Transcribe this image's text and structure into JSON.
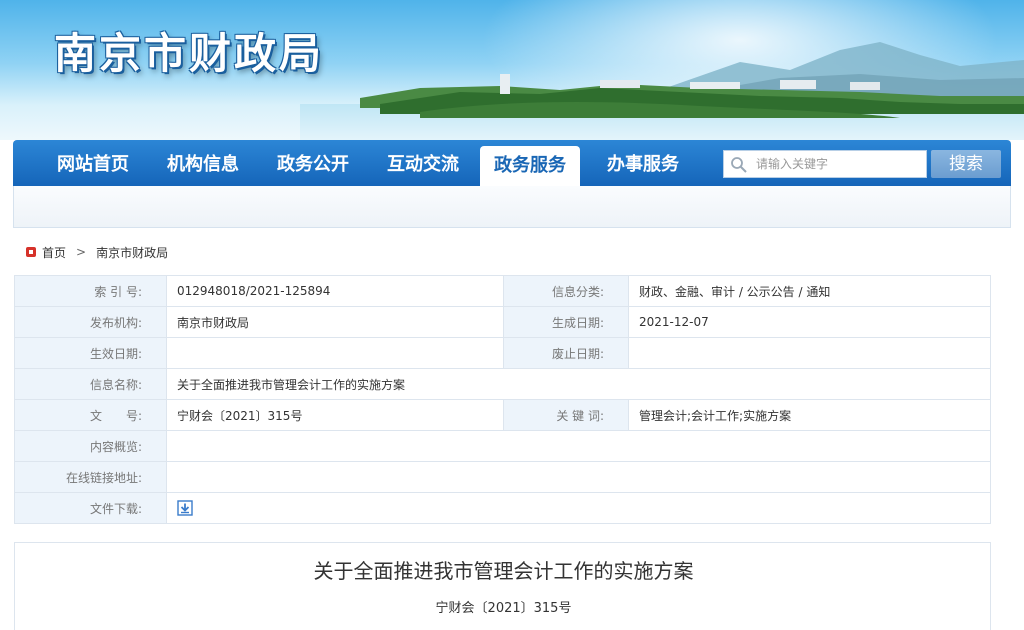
{
  "site": {
    "title": "南京市财政局"
  },
  "nav": {
    "items": [
      {
        "label": "网站首页",
        "active": false
      },
      {
        "label": "机构信息",
        "active": false
      },
      {
        "label": "政务公开",
        "active": false
      },
      {
        "label": "互动交流",
        "active": false
      },
      {
        "label": "政务服务",
        "active": true
      },
      {
        "label": "办事服务",
        "active": false
      }
    ],
    "search_placeholder": "请输入关键字",
    "search_button": "搜索"
  },
  "breadcrumb": {
    "home": "首页",
    "separator": ">",
    "current": "南京市财政局"
  },
  "info": {
    "index_label": "索 引 号:",
    "index_value": "012948018/2021-125894",
    "category_label": "信息分类:",
    "category_value": "财政、金融、审计 / 公示公告 / 通知",
    "publisher_label": "发布机构:",
    "publisher_value": "南京市财政局",
    "created_label": "生成日期:",
    "created_value": "2021-12-07",
    "effective_label": "生效日期:",
    "effective_value": "",
    "abolish_label": "废止日期:",
    "abolish_value": "",
    "name_label": "信息名称:",
    "name_value": "关于全面推进我市管理会计工作的实施方案",
    "docno_label": "文　　号:",
    "docno_value": "宁财会〔2021〕315号",
    "keywords_label": "关 键 词:",
    "keywords_value": "管理会计;会计工作;实施方案",
    "summary_label": "内容概览:",
    "summary_value": "",
    "link_label": "在线链接地址:",
    "link_value": "",
    "download_label": "文件下载:"
  },
  "document": {
    "title": "关于全面推进我市管理会计工作的实施方案",
    "number": "宁财会〔2021〕315号"
  },
  "colors": {
    "nav_blue": "#1a67b5",
    "label_bg": "#edf4fb",
    "home_icon_red": "#d6322a"
  }
}
